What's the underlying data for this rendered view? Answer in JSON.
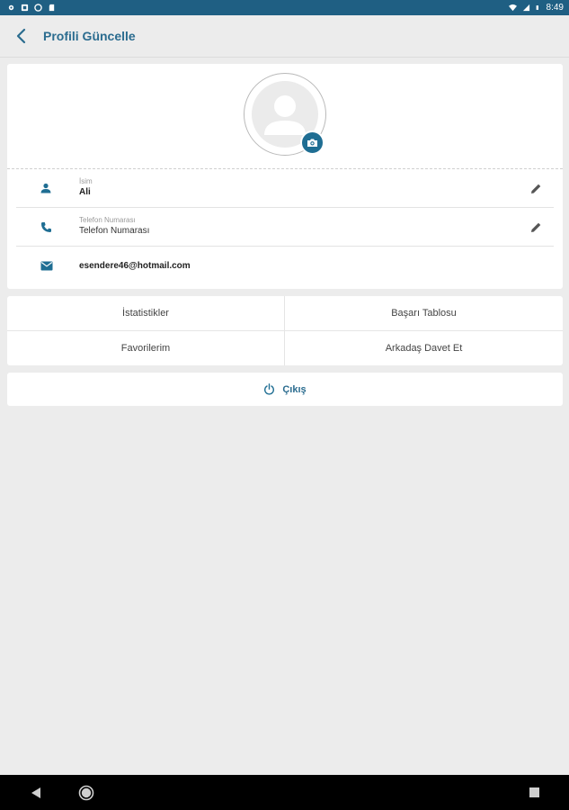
{
  "status_bar": {
    "time": "8:49"
  },
  "app_bar": {
    "title": "Profili Güncelle"
  },
  "profile": {
    "name_label": "İsim",
    "name_value": "Ali",
    "phone_label": "Telefon Numarası",
    "phone_placeholder": "Telefon Numarası",
    "email_value": "esendere46@hotmail.com"
  },
  "menu": {
    "statistics": "İstatistikler",
    "leaderboard": "Başarı Tablosu",
    "favorites": "Favorilerim",
    "invite_friend": "Arkadaş Davet Et"
  },
  "logout": {
    "label": "Çıkış"
  },
  "colors": {
    "primary": "#1f6e93",
    "status_bar": "#1f5f83",
    "background": "#ececec"
  },
  "icons": {
    "back": "chevron-left-icon",
    "camera": "camera-icon",
    "person": "person-icon",
    "phone": "phone-icon",
    "email": "email-icon",
    "edit": "pencil-icon",
    "power": "power-icon"
  }
}
